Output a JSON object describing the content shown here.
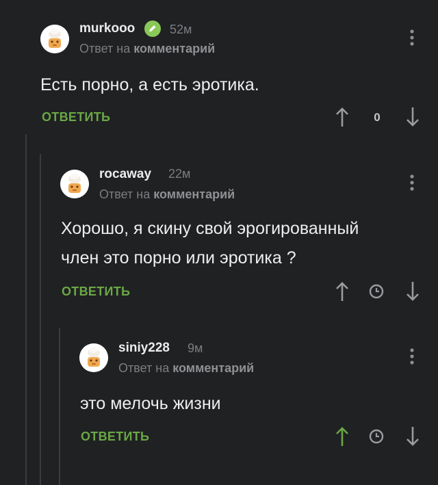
{
  "comments": [
    {
      "username": "murkooo",
      "time": "52м",
      "reply_prefix": "Ответ на",
      "reply_target": "комментарий",
      "text": "Есть порно, а есть эротика.",
      "reply_label": "ОТВЕТИТЬ",
      "rating": "0"
    },
    {
      "username": "rocaway",
      "time": "22м",
      "reply_prefix": "Ответ на",
      "reply_target": "комментарий",
      "text_line1": "Хорошо, я скину свой эрогированный",
      "text_line2": "член это порно или эротика ?",
      "reply_label": "ОТВЕТИТЬ"
    },
    {
      "username": "siniy228",
      "time": "9м",
      "reply_prefix": "Ответ на",
      "reply_target": "комментарий",
      "text": "это мелочь жизни",
      "reply_label": "ОТВЕТИТЬ",
      "upvoted": true
    }
  ],
  "icons": {
    "avatar": "default-avatar-icon",
    "badge": "pencil-badge-icon",
    "more": "more-vertical-icon",
    "upvote": "arrow-up-icon",
    "downvote": "arrow-down-icon",
    "rating_timer": "clock-icon"
  },
  "colors": {
    "background": "#202123",
    "accent_green": "#6aa845",
    "badge_green": "#8ac858",
    "muted_text": "#7b7d80"
  }
}
